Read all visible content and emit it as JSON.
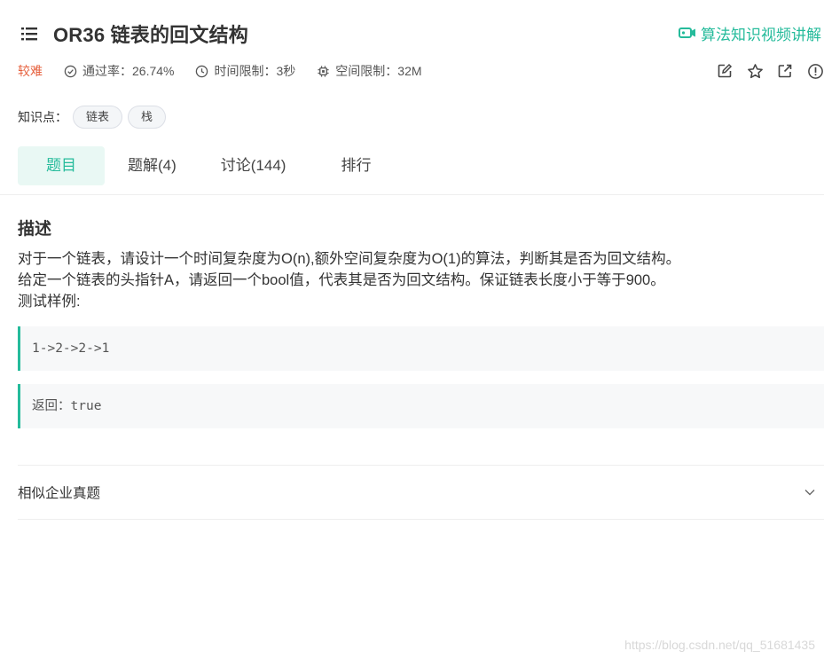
{
  "problem": {
    "id": "OR36",
    "title": "OR36  链表的回文结构"
  },
  "video_link": "算法知识视频讲解",
  "meta": {
    "difficulty": "较难",
    "pass_rate": "通过率：26.74%",
    "time_limit": "时间限制：3秒",
    "space_limit": "空间限制：32M"
  },
  "knowledge": {
    "label": "知识点：",
    "tags": [
      "链表",
      "栈"
    ]
  },
  "tabs": [
    {
      "label": "题目",
      "active": true
    },
    {
      "label": "题解(4)",
      "active": false
    },
    {
      "label": "讨论(144)",
      "active": false
    },
    {
      "label": "排行",
      "active": false
    }
  ],
  "description": {
    "heading": "描述",
    "lines": [
      "对于一个链表，请设计一个时间复杂度为O(n),额外空间复杂度为O(1)的算法，判断其是否为回文结构。",
      "给定一个链表的头指针A，请返回一个bool值，代表其是否为回文结构。保证链表长度小于等于900。",
      "测试样例:"
    ]
  },
  "samples": {
    "input": "1->2->2->1",
    "output": "返回：true"
  },
  "similar_section": "相似企业真题",
  "watermark": "https://blog.csdn.net/qq_51681435",
  "colors": {
    "accent": "#25bb9b",
    "difficulty": "#e6603d",
    "tab_active_bg": "#e9f8f4"
  },
  "icons": [
    "list-icon",
    "video-icon",
    "check-circle-icon",
    "clock-icon",
    "chip-icon",
    "edit-icon",
    "star-icon",
    "share-icon",
    "info-icon",
    "chevron-down-icon"
  ]
}
